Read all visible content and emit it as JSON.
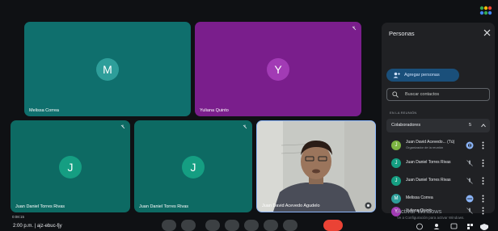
{
  "tiles": {
    "melissa": {
      "initial": "M",
      "name": "Melissa Correa",
      "avatar_color": "#2e9e9a"
    },
    "yuliana": {
      "initial": "Y",
      "name": "Yuliana Quinto",
      "avatar_color": "#a23bb5"
    },
    "juan1": {
      "initial": "J",
      "name": "Juan Daniel Torres Rivas",
      "avatar_color": "#159e82"
    },
    "juan2": {
      "initial": "J",
      "name": "Juan Daniel Torres Rivas",
      "avatar_color": "#159e82"
    },
    "camera": {
      "name": "Juan David Acevedo Agudelo"
    }
  },
  "panel": {
    "title": "Personas",
    "add_label": "Agregar personas",
    "search_placeholder": "Buscar contactos",
    "section": "EN LA REUNIÓN",
    "group_label": "Colaboradores",
    "group_count": "5",
    "people": [
      {
        "initial": "J",
        "name": "Juan David Acevedo... (Tú)",
        "sub": "Organizador de la reunión",
        "color": "#7cb342",
        "status": "speaking"
      },
      {
        "initial": "J",
        "name": "Juan Daniel Torres Rivas",
        "sub": "",
        "color": "#159e82",
        "status": "mic-off"
      },
      {
        "initial": "J",
        "name": "Juan Daniel Torres Rivas",
        "sub": "",
        "color": "#159e82",
        "status": "mic-off"
      },
      {
        "initial": "M",
        "name": "Melissa Correa",
        "sub": "",
        "color": "#2e9e9a",
        "status": "speaking-dots"
      },
      {
        "initial": "Y",
        "name": "Yuliana Quinto",
        "sub": "",
        "color": "#a23bb5",
        "status": "mic-off"
      }
    ]
  },
  "bottom": {
    "time": "0:08:15",
    "meeting_code": "2:00 p.m. | ajz-ebuc-fjy",
    "activate_title": "Activar Windows",
    "activate_sub": "Ve a Configuración para activar Windows."
  },
  "colors": {
    "accent": "#8ab4f8",
    "end_call": "#ea4335"
  }
}
